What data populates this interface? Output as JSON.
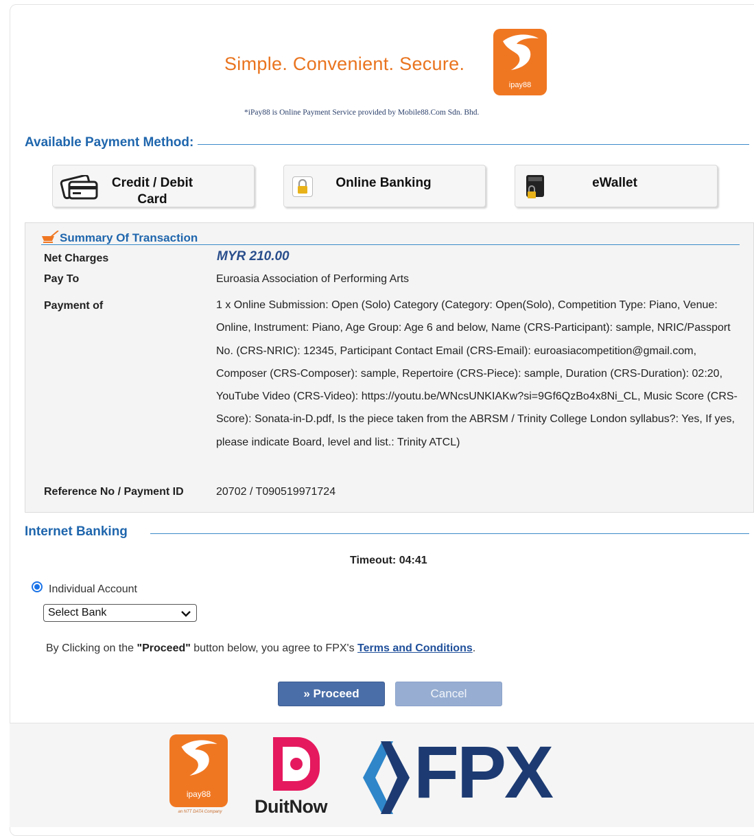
{
  "header": {
    "tagline": "Simple. Convenient. Secure.",
    "logo_text": "ipay88",
    "disclaimer": "*iPay88 is Online Payment Service provided by Mobile88.Com Sdn. Bhd."
  },
  "methods": {
    "heading": "Available Payment Method:",
    "items": [
      {
        "line1": "Credit / Debit",
        "line2": "Card",
        "icon": "credit-card-icon"
      },
      {
        "line1": "Online Banking",
        "icon": "lock-icon"
      },
      {
        "line1": "eWallet",
        "icon": "wallet-icon"
      }
    ]
  },
  "summary": {
    "title": "Summary Of Transaction",
    "rows": [
      {
        "label": "Net Charges",
        "value": "MYR 210.00"
      },
      {
        "label": "Pay To",
        "value": "Euroasia Association of Performing Arts"
      },
      {
        "label": "Payment of",
        "value": "1 x Online Submission: Open (Solo) Category (Category: Open(Solo), Competition Type: Piano, Venue: Online, Instrument: Piano, Age Group: Age 6 and below, Name (CRS-Participant): sample, NRIC/Passport No. (CRS-NRIC): 12345, Participant Contact Email (CRS-Email): euroasiacompetition@gmail.com, Composer (CRS-Composer): sample, Repertoire (CRS-Piece): sample, Duration (CRS-Duration): 02:20, YouTube Video (CRS-Video): https://youtu.be/WNcsUNKIAKw?si=9Gf6QzBo4x8Ni_CL, Music Score (CRS-Score): Sonata-in-D.pdf, Is the piece taken from the ABRSM / Trinity College London syllabus?: Yes, If yes, please indicate Board, level and list.: Trinity ATCL)"
      },
      {
        "label": "Reference No / Payment ID",
        "value": "20702 / T090519971724"
      }
    ]
  },
  "banking": {
    "heading": "Internet Banking",
    "timeout": "Timeout: 04:41",
    "account_type": "Individual Account",
    "select_bank": "Select Bank",
    "agree_pre": "By Clicking on the ",
    "agree_bold": "\"Proceed\"",
    "agree_mid": " button below, you agree to FPX's ",
    "agree_link": "Terms and Conditions",
    "agree_end": ".",
    "proceed": "» Proceed",
    "cancel": "Cancel"
  },
  "footer": {
    "ipay_text": "ipay88",
    "ipay_sub": "an NTT DATA Company",
    "duitnow": "DuitNow",
    "fpx": "FPX"
  },
  "colors": {
    "brand_orange": "#f07722",
    "heading_blue": "#1f66ad",
    "proceed_blue": "#4a6ea8",
    "duitnow_pink": "#e5195e",
    "fpx_navy": "#1d3b72",
    "fpx_light": "#2f86c9"
  }
}
